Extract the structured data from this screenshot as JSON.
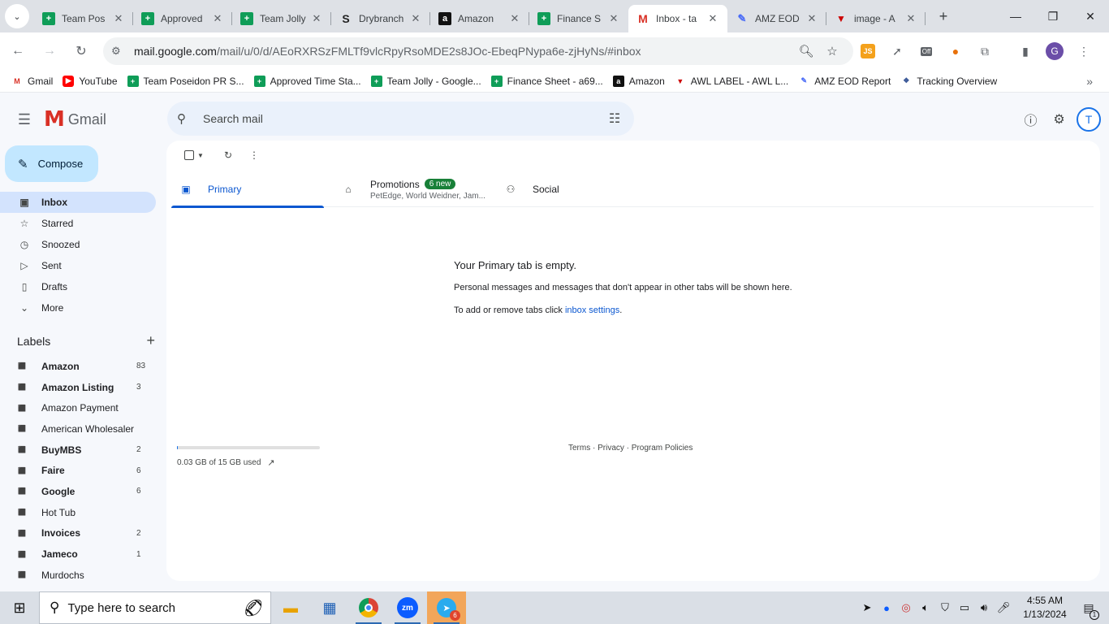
{
  "browser": {
    "tabs": [
      {
        "title": "Team Pos",
        "fav": "sheets-icon",
        "fav_text": "+"
      },
      {
        "title": "Approved",
        "fav": "sheets-icon",
        "fav_text": "+"
      },
      {
        "title": "Team Jolly",
        "fav": "sheets-icon",
        "fav_text": "+"
      },
      {
        "title": "Drybranch",
        "fav": "drybranch-icon",
        "fav_text": "S"
      },
      {
        "title": "Amazon",
        "fav": "amazon-icon",
        "fav_text": "a"
      },
      {
        "title": "Finance S",
        "fav": "sheets-icon",
        "fav_text": "+"
      },
      {
        "title": "Inbox - ta",
        "fav": "gmail-icon",
        "fav_text": "M"
      },
      {
        "title": "AMZ EOD",
        "fav": "amz-eod-icon",
        "fav_text": "✎"
      },
      {
        "title": "image - A",
        "fav": "awl-icon",
        "fav_text": "▼"
      }
    ],
    "url_host": "mail.google.com",
    "url_path": "/mail/u/0/d/AEoRXRSzFMLTf9vlcRpyRsoMDE2s8JOc-EbeqPNypa6e-zjHyNs/#inbox",
    "ext_js": "JS",
    "ext_off": "Off",
    "profile_letter": "G",
    "bookmarks": [
      {
        "title": "Gmail",
        "fav": "gmail-icon",
        "fav_text": "M"
      },
      {
        "title": "YouTube",
        "fav": "youtube-icon",
        "fav_text": "▶"
      },
      {
        "title": "Team Poseidon PR S...",
        "fav": "sheets-icon",
        "fav_text": "+"
      },
      {
        "title": "Approved Time Sta...",
        "fav": "sheets-icon",
        "fav_text": "+"
      },
      {
        "title": "Team Jolly - Google...",
        "fav": "sheets-icon",
        "fav_text": "+"
      },
      {
        "title": "Finance Sheet - a69...",
        "fav": "sheets-icon",
        "fav_text": "+"
      },
      {
        "title": "Amazon",
        "fav": "amazon-icon",
        "fav_text": "a"
      },
      {
        "title": "AWL LABEL - AWL L...",
        "fav": "awl-icon",
        "fav_text": "▼"
      },
      {
        "title": "AMZ EOD Report",
        "fav": "amz-eod-icon",
        "fav_text": "✎"
      },
      {
        "title": "Tracking Overview",
        "fav": "tracking-icon",
        "fav_text": "❖"
      }
    ]
  },
  "gmail": {
    "logo_text": "Gmail",
    "search_placeholder": "Search mail",
    "avatar_letter": "T",
    "compose_label": "Compose",
    "nav": [
      {
        "label": "Inbox",
        "icon": "inbox-icon",
        "glyph": "▣",
        "active": true
      },
      {
        "label": "Starred",
        "icon": "star-icon",
        "glyph": "☆",
        "active": false
      },
      {
        "label": "Snoozed",
        "icon": "clock-icon",
        "glyph": "◷",
        "active": false
      },
      {
        "label": "Sent",
        "icon": "send-icon",
        "glyph": "▷",
        "active": false
      },
      {
        "label": "Drafts",
        "icon": "draft-icon",
        "glyph": "▯",
        "active": false
      },
      {
        "label": "More",
        "icon": "chevron-down-icon",
        "glyph": "⌄",
        "active": false
      }
    ],
    "labels_title": "Labels",
    "labels": [
      {
        "name": "Amazon",
        "count": "83",
        "bold": true
      },
      {
        "name": "Amazon Listing",
        "count": "3",
        "bold": true
      },
      {
        "name": "Amazon Payment",
        "count": "",
        "bold": false
      },
      {
        "name": "American Wholesaler",
        "count": "",
        "bold": false
      },
      {
        "name": "BuyMBS",
        "count": "2",
        "bold": true
      },
      {
        "name": "Faire",
        "count": "6",
        "bold": true
      },
      {
        "name": "Google",
        "count": "6",
        "bold": true
      },
      {
        "name": "Hot Tub",
        "count": "",
        "bold": false
      },
      {
        "name": "Invoices",
        "count": "2",
        "bold": true
      },
      {
        "name": "Jameco",
        "count": "1",
        "bold": true
      },
      {
        "name": "Murdochs",
        "count": "",
        "bold": false
      }
    ],
    "tabs": {
      "primary": "Primary",
      "promotions": "Promotions",
      "promotions_badge": "6 new",
      "promotions_senders": "PetEdge, World Weidner, Jam...",
      "social": "Social"
    },
    "empty": {
      "title": "Your Primary tab is empty.",
      "line1": "Personal messages and messages that don't appear in other tabs will be shown here.",
      "line2_prefix": "To add or remove tabs click ",
      "line2_link": "inbox settings",
      "line2_suffix": "."
    },
    "storage": {
      "text": "0.03 GB of 15 GB used",
      "fraction": 0.002
    },
    "footer": "Terms · Privacy · Program Policies"
  },
  "taskbar": {
    "search_placeholder": "Type here to search",
    "zoom_text": "zm",
    "telegram_badge": "6",
    "time": "4:55 AM",
    "date": "1/13/2024",
    "notif_count": "1"
  }
}
